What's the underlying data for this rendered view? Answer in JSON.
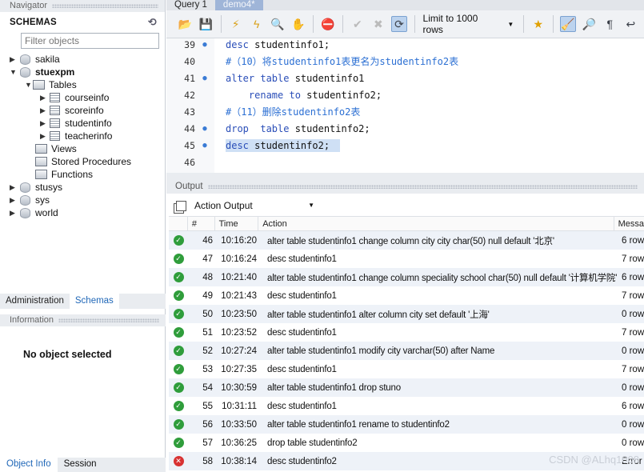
{
  "navigator": {
    "header": "Navigator",
    "schemas_title": "SCHEMAS",
    "filter_placeholder": "Filter objects",
    "tree": {
      "sakila": "sakila",
      "stuexpm": "stuexpm",
      "tables": "Tables",
      "table_items": [
        "courseinfo",
        "scoreinfo",
        "studentinfo",
        "teacherinfo"
      ],
      "views": "Views",
      "procedures": "Stored Procedures",
      "functions": "Functions",
      "stusys": "stusys",
      "sys": "sys",
      "world": "world"
    },
    "tabs": [
      "Administration",
      "Schemas"
    ],
    "info_header": "Information",
    "info_text": "No object selected",
    "bottom_tabs": [
      "Object Info",
      "Session"
    ]
  },
  "doc_tabs": [
    "Query 1",
    "demo4*"
  ],
  "toolbar": {
    "limit_label": "Limit to 1000 rows"
  },
  "editor": {
    "lines": [
      {
        "num": "39",
        "text": "desc studentinfo1;"
      },
      {
        "num": "40",
        "text": "#（10）将studentinfo1表更名为studentinfo2表"
      },
      {
        "num": "41",
        "text": "alter table studentinfo1"
      },
      {
        "num": "42",
        "text": "    rename to studentinfo2;"
      },
      {
        "num": "43",
        "text": "#（11）删除studentinfo2表"
      },
      {
        "num": "44",
        "text": "drop  table studentinfo2;"
      },
      {
        "num": "45",
        "text": "desc studentinfo2;"
      },
      {
        "num": "46",
        "text": ""
      }
    ]
  },
  "output": {
    "header": "Output",
    "selector": "Action Output",
    "columns": [
      "#",
      "Time",
      "Action",
      "Messa"
    ],
    "rows": [
      {
        "status": "ok",
        "num": "46",
        "time": "10:16:20",
        "action": "alter table studentinfo1 change column city city char(50) null default '北京'",
        "msg": "6 row("
      },
      {
        "status": "ok",
        "num": "47",
        "time": "10:16:24",
        "action": "desc studentinfo1",
        "msg": "7 row("
      },
      {
        "status": "ok",
        "num": "48",
        "time": "10:21:40",
        "action": "alter table studentinfo1 change column speciality school char(50) null default '计算机学院'",
        "msg": "6 row("
      },
      {
        "status": "ok",
        "num": "49",
        "time": "10:21:43",
        "action": "desc studentinfo1",
        "msg": "7 row("
      },
      {
        "status": "ok",
        "num": "50",
        "time": "10:23:50",
        "action": "alter table studentinfo1 alter column city set default '上海'",
        "msg": "0 row("
      },
      {
        "status": "ok",
        "num": "51",
        "time": "10:23:52",
        "action": "desc studentinfo1",
        "msg": "7 row("
      },
      {
        "status": "ok",
        "num": "52",
        "time": "10:27:24",
        "action": "alter table studentinfo1 modify city varchar(50) after Name",
        "msg": "0 row("
      },
      {
        "status": "ok",
        "num": "53",
        "time": "10:27:35",
        "action": "desc studentinfo1",
        "msg": "7 row("
      },
      {
        "status": "ok",
        "num": "54",
        "time": "10:30:59",
        "action": "alter table studentinfo1 drop stuno",
        "msg": "0 row("
      },
      {
        "status": "ok",
        "num": "55",
        "time": "10:31:11",
        "action": "desc studentinfo1",
        "msg": "6 row("
      },
      {
        "status": "ok",
        "num": "56",
        "time": "10:33:50",
        "action": "alter table studentinfo1 rename to studentinfo2",
        "msg": "0 row("
      },
      {
        "status": "ok",
        "num": "57",
        "time": "10:36:25",
        "action": "drop  table studentinfo2",
        "msg": "0 row("
      },
      {
        "status": "err",
        "num": "58",
        "time": "10:38:14",
        "action": "desc studentinfo2",
        "msg": "Error C"
      }
    ]
  },
  "watermark": "CSDN @ALhq1008"
}
